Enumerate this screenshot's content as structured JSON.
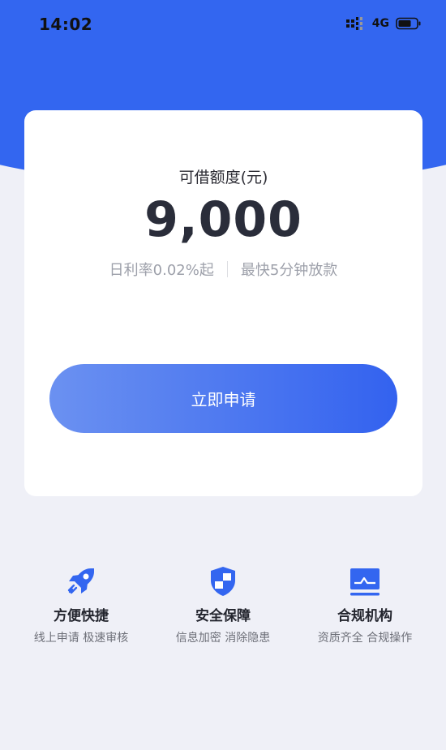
{
  "status_bar": {
    "time": "14:02",
    "network": "4G",
    "icons": [
      "signal-icon",
      "battery-icon"
    ]
  },
  "card": {
    "quota_label": "可借额度(元)",
    "quota_amount": "9,000",
    "rate_text": "日利率0.02%起",
    "speed_text": "最快5分钟放款",
    "apply_button_label": "立即申请"
  },
  "features": [
    {
      "icon": "rocket-icon",
      "title": "方便快捷",
      "desc": "线上申请 极速审核"
    },
    {
      "icon": "shield-icon",
      "title": "安全保障",
      "desc": "信息加密 消除隐患"
    },
    {
      "icon": "monitor-icon",
      "title": "合规机构",
      "desc": "资质齐全 合规操作"
    }
  ],
  "colors": {
    "primary": "#3366f0",
    "gradient_start": "#6b91f1",
    "gradient_end": "#3362ef",
    "background": "#eff0f7",
    "card": "#ffffff"
  }
}
